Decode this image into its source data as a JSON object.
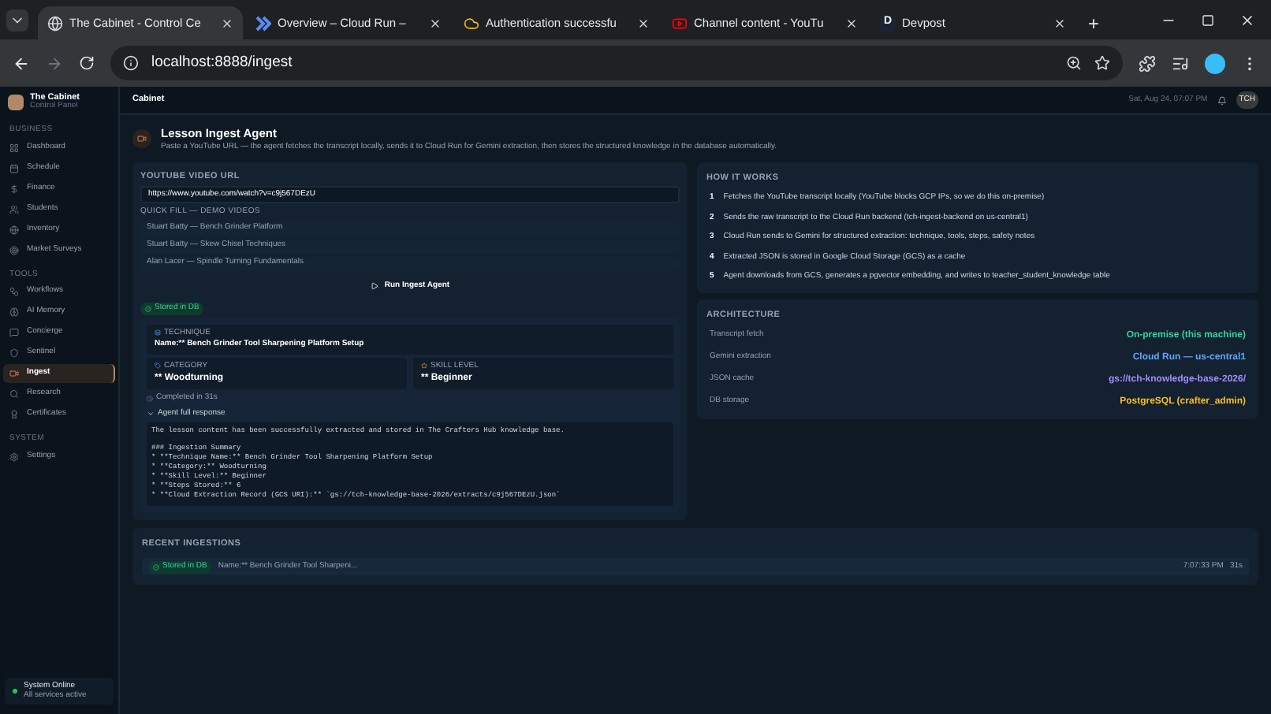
{
  "browser": {
    "tabs": [
      {
        "title": "The Cabinet - Control Ce",
        "kind": "globe",
        "selected": true
      },
      {
        "title": "Overview – Cloud Run – ",
        "kind": "run",
        "selected": false
      },
      {
        "title": "Authentication successfu",
        "kind": "cloud",
        "selected": false
      },
      {
        "title": "Channel content - YouTu",
        "kind": "youtube",
        "selected": false
      },
      {
        "title": "Devpost",
        "kind": "devpost",
        "selected": false
      }
    ],
    "new_tab": "+",
    "address": "localhost:8888/ingest",
    "devpost_letter": "D"
  },
  "sidebar": {
    "brand": "The Cabinet",
    "subtitle": "Control Panel",
    "sections": [
      {
        "heading": "BUSINESS",
        "items": [
          {
            "label": "Dashboard",
            "selected": false
          },
          {
            "label": "Schedule",
            "selected": false
          },
          {
            "label": "Finance",
            "selected": false
          },
          {
            "label": "Students",
            "selected": false
          },
          {
            "label": "Inventory",
            "selected": false
          },
          {
            "label": "Market Surveys",
            "selected": false
          }
        ]
      },
      {
        "heading": "TOOLS",
        "items": [
          {
            "label": "Workflows",
            "selected": false
          },
          {
            "label": "AI Memory",
            "selected": false
          },
          {
            "label": "Concierge",
            "selected": false
          },
          {
            "label": "Sentinel",
            "selected": false
          },
          {
            "label": "Ingest",
            "selected": true
          },
          {
            "label": "Research",
            "selected": false
          },
          {
            "label": "Certificates",
            "selected": false
          }
        ]
      },
      {
        "heading": "SYSTEM",
        "items": [
          {
            "label": "Settings",
            "selected": false
          }
        ]
      }
    ],
    "status": {
      "title": "System Online",
      "detail": "All services active"
    }
  },
  "header": {
    "title": "Cabinet",
    "date": "Sat, Aug 24, 07:07 PM",
    "avatar": "TCH"
  },
  "page": {
    "title": "Lesson Ingest Agent",
    "description": "Paste a YouTube URL — the agent fetches the transcript locally, sends it to Cloud Run for Gemini extraction, then stores the structured knowledge in the database automatically."
  },
  "form": {
    "label": "YOUTUBE VIDEO URL",
    "url": "https://www.youtube.com/watch?v=c9j567DEzU",
    "quick_label": "QUICK FILL — DEMO VIDEOS",
    "quick": [
      "Stuart Batty — Bench Grinder Platform",
      "Stuart Batty — Skew Chisel Techniques",
      "Alan Lacer — Spindle Turning Fundamentals"
    ],
    "run_button": "Run Ingest Agent"
  },
  "result": {
    "badge": "Stored in DB",
    "technique_label": "TECHNIQUE",
    "technique": "Name:** Bench Grinder Tool Sharpening Platform Setup",
    "category_label": "CATEGORY",
    "category": "** Woodturning",
    "skill_label": "SKILL LEVEL",
    "skill": "** Beginner",
    "completed": "Completed in 31s",
    "response_toggle": "Agent full response",
    "expanded": true,
    "response_intro": "The lesson content has been successfully extracted and stored in The Crafters Hub knowledge base.",
    "response_summary": [
      "### Ingestion Summary",
      "* **Technique Name:** Bench Grinder Tool Sharpening Platform Setup",
      "* **Category:** Woodturning",
      "* **Skill Level:** Beginner",
      "* **Steps Stored:** 6",
      "* **Cloud Extraction Record (GCS URI):** `gs://tch-knowledge-base-2026/extracts/c9j567DEzU.json`"
    ]
  },
  "how_it_works": {
    "title": "HOW IT WORKS",
    "steps": [
      {
        "n": "1",
        "text": "Fetches the YouTube transcript locally (YouTube blocks GCP IPs, so we do this on-premise)"
      },
      {
        "n": "2",
        "text": "Sends the raw transcript to the Cloud Run backend (tch-ingest-backend on us-central1)"
      },
      {
        "n": "3",
        "text": "Cloud Run sends to Gemini for structured extraction: technique, tools, steps, safety notes"
      },
      {
        "n": "4",
        "text": "Extracted JSON is stored in Google Cloud Storage (GCS) as a cache"
      },
      {
        "n": "5",
        "text": "Agent downloads from GCS, generates a pgvector embedding, and writes to teacher_student_knowledge table"
      }
    ]
  },
  "architecture": {
    "title": "ARCHITECTURE",
    "rows": [
      {
        "label": "Transcript fetch",
        "value": "On-premise (this machine)",
        "color": "#34d399"
      },
      {
        "label": "Gemini extraction",
        "value": "Cloud Run — us-central1",
        "color": "#60a5fa"
      },
      {
        "label": "JSON cache",
        "value": "gs://tch-knowledge-base-2026/",
        "color": "#a78bfa"
      },
      {
        "label": "DB storage",
        "value": "PostgreSQL (crafter_admin)",
        "color": "#fbbf24"
      }
    ]
  },
  "recent": {
    "title": "RECENT INGESTIONS",
    "rows": [
      {
        "badge": "Stored in DB",
        "name": "Name:** Bench Grinder Tool Sharpeni...",
        "time": "7:07:33 PM",
        "duration": "31s"
      }
    ]
  }
}
